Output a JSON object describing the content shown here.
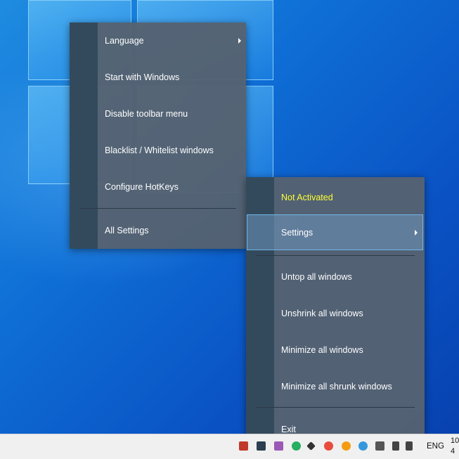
{
  "settings_menu": {
    "items": [
      {
        "label": "Language",
        "submenu": true
      },
      {
        "label": "Start with Windows",
        "submenu": false
      },
      {
        "label": "Disable toolbar menu",
        "submenu": false
      },
      {
        "label": "Blacklist / Whitelist windows",
        "submenu": false
      },
      {
        "label": "Configure HotKeys",
        "submenu": false
      }
    ],
    "footer_item": {
      "label": "All Settings"
    }
  },
  "main_menu": {
    "status": {
      "label": "Not Activated",
      "color": "#ffff33"
    },
    "settings": {
      "label": "Settings",
      "submenu": true
    },
    "actions": [
      {
        "label": "Untop all windows"
      },
      {
        "label": "Unshrink all windows"
      },
      {
        "label": "Minimize all windows"
      },
      {
        "label": "Minimize all shrunk windows"
      }
    ],
    "exit": {
      "label": "Exit"
    }
  },
  "taskbar": {
    "language": "ENG",
    "clock_line1": "10",
    "clock_line2": "4",
    "tray_icons": [
      "app-tray-icon",
      "app-tray-icon",
      "app-tray-icon",
      "app-tray-icon",
      "app-tray-icon",
      "app-tray-icon",
      "app-tray-icon",
      "app-tray-icon",
      "app-tray-icon",
      "app-tray-icon",
      "app-tray-icon",
      "app-tray-icon"
    ]
  },
  "colors": {
    "menu_bg": "#55626f",
    "menu_strip": "#334a5d",
    "highlight_border": "#6fb6e8",
    "status_text": "#ffff33"
  }
}
